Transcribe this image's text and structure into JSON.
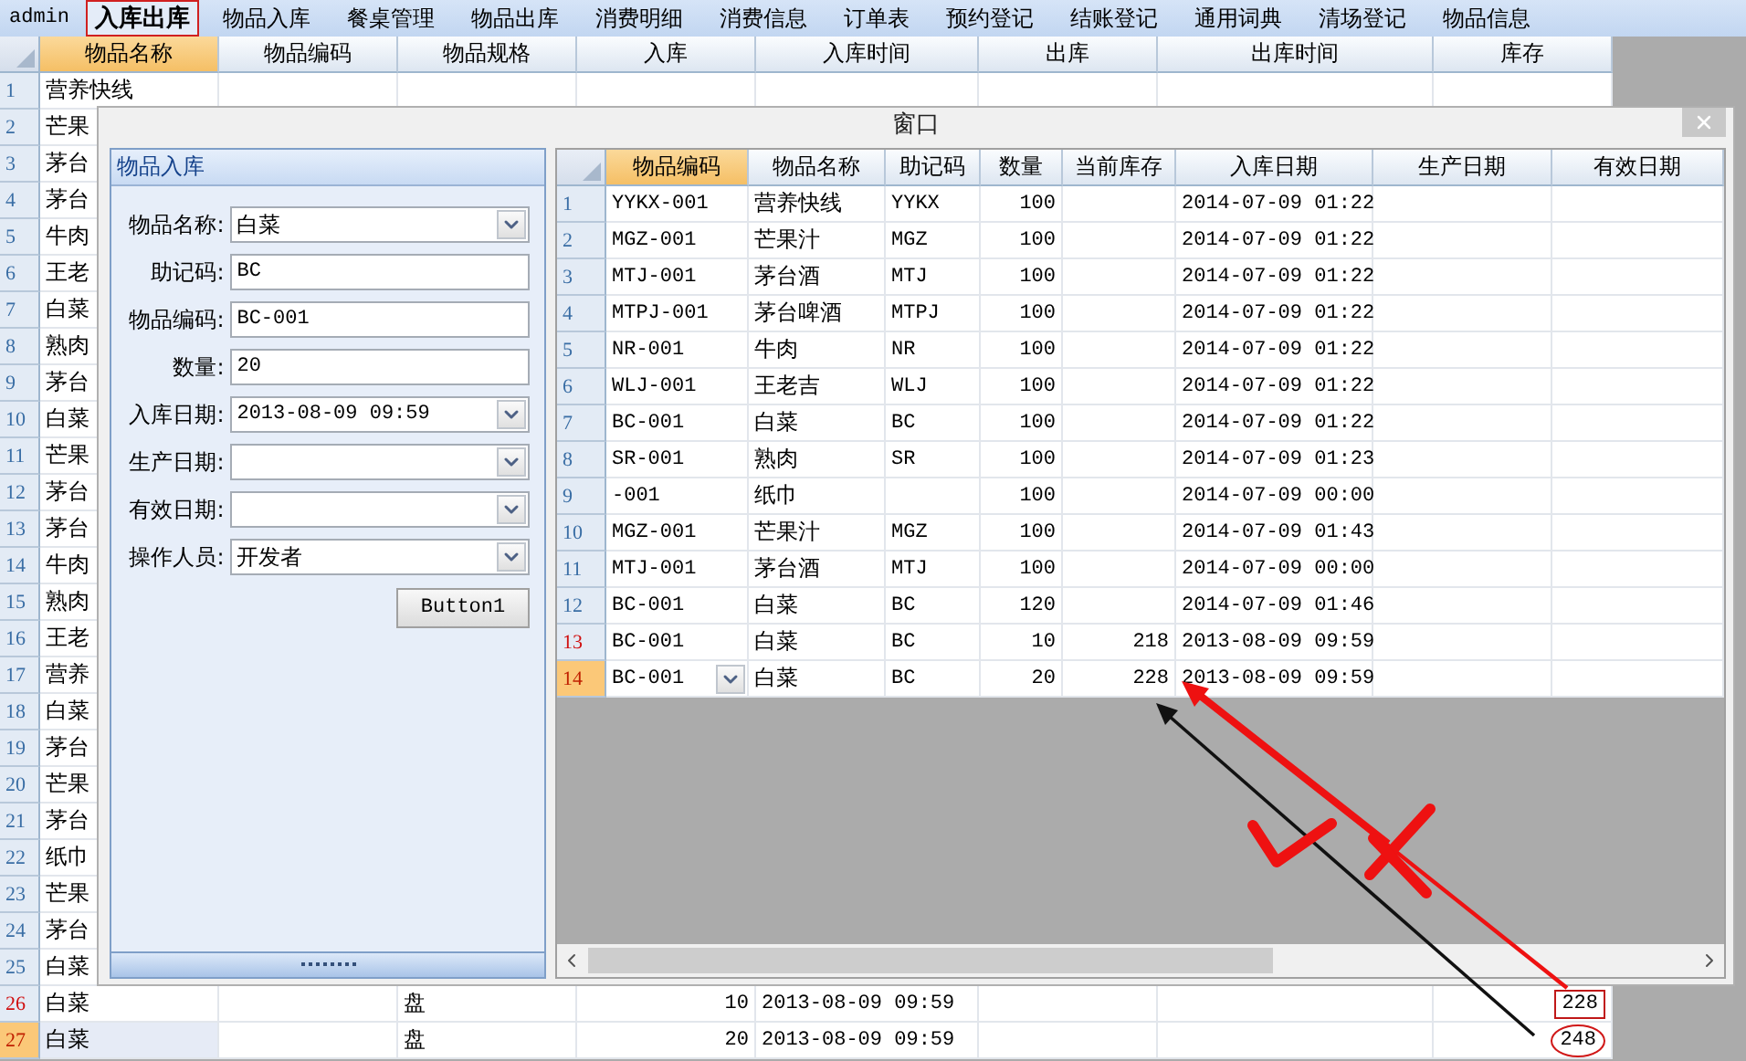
{
  "menu": {
    "user": "admin",
    "items": [
      {
        "label": "入库出库",
        "selected": true
      },
      {
        "label": "物品入库",
        "selected": false
      },
      {
        "label": "餐桌管理",
        "selected": false
      },
      {
        "label": "物品出库",
        "selected": false
      },
      {
        "label": "消费明细",
        "selected": false
      },
      {
        "label": "消费信息",
        "selected": false
      },
      {
        "label": "订单表",
        "selected": false
      },
      {
        "label": "预约登记",
        "selected": false
      },
      {
        "label": "结账登记",
        "selected": false
      },
      {
        "label": "通用词典",
        "selected": false
      },
      {
        "label": "清场登记",
        "selected": false
      },
      {
        "label": "物品信息",
        "selected": false
      }
    ]
  },
  "main_grid": {
    "columns": [
      {
        "label": "物品名称",
        "selected": true
      },
      {
        "label": "物品编码",
        "selected": false
      },
      {
        "label": "物品规格",
        "selected": false
      },
      {
        "label": "入库",
        "selected": false
      },
      {
        "label": "入库时间",
        "selected": false
      },
      {
        "label": "出库",
        "selected": false
      },
      {
        "label": "出库时间",
        "selected": false
      },
      {
        "label": "库存",
        "selected": false
      }
    ],
    "rows": [
      {
        "number": "1",
        "name": "营养快线",
        "selected": false,
        "modified": false
      },
      {
        "number": "2",
        "name": "芒果",
        "selected": false,
        "modified": false
      },
      {
        "number": "3",
        "name": "茅台",
        "selected": false,
        "modified": false
      },
      {
        "number": "4",
        "name": "茅台",
        "selected": false,
        "modified": false
      },
      {
        "number": "5",
        "name": "牛肉",
        "selected": false,
        "modified": false
      },
      {
        "number": "6",
        "name": "王老",
        "selected": false,
        "modified": false
      },
      {
        "number": "7",
        "name": "白菜",
        "selected": false,
        "modified": false
      },
      {
        "number": "8",
        "name": "熟肉",
        "selected": false,
        "modified": false
      },
      {
        "number": "9",
        "name": "茅台",
        "selected": false,
        "modified": false
      },
      {
        "number": "10",
        "name": "白菜",
        "selected": false,
        "modified": false
      },
      {
        "number": "11",
        "name": "芒果",
        "selected": false,
        "modified": false
      },
      {
        "number": "12",
        "name": "茅台",
        "selected": false,
        "modified": false
      },
      {
        "number": "13",
        "name": "茅台",
        "selected": false,
        "modified": false
      },
      {
        "number": "14",
        "name": "牛肉",
        "selected": false,
        "modified": false
      },
      {
        "number": "15",
        "name": "熟肉",
        "selected": false,
        "modified": false
      },
      {
        "number": "16",
        "name": "王老",
        "selected": false,
        "modified": false
      },
      {
        "number": "17",
        "name": "营养",
        "selected": false,
        "modified": false
      },
      {
        "number": "18",
        "name": "白菜",
        "selected": false,
        "modified": false
      },
      {
        "number": "19",
        "name": "茅台",
        "selected": false,
        "modified": false
      },
      {
        "number": "20",
        "name": "芒果",
        "selected": false,
        "modified": false
      },
      {
        "number": "21",
        "name": "茅台",
        "selected": false,
        "modified": false
      },
      {
        "number": "22",
        "name": "纸巾",
        "selected": false,
        "modified": false
      },
      {
        "number": "23",
        "name": "芒果",
        "selected": false,
        "modified": false
      },
      {
        "number": "24",
        "name": "茅台",
        "selected": false,
        "modified": false
      },
      {
        "number": "25",
        "name": "白菜",
        "selected": false,
        "modified": false
      },
      {
        "number": "26",
        "name": "白菜",
        "spec": "盘",
        "in": "10",
        "in_time": "2013-08-09 09:59",
        "stock": {
          "value": "228",
          "kind": "boxed"
        },
        "selected": false,
        "modified": true
      },
      {
        "number": "27",
        "name": "白菜",
        "spec": "盘",
        "in": "20",
        "in_time": "2013-08-09 09:59",
        "stock": {
          "value": "248",
          "kind": "circled"
        },
        "selected": true,
        "modified": false
      }
    ]
  },
  "dialog": {
    "title": "窗口",
    "form": {
      "title": "物品入库",
      "fields": [
        {
          "label": "物品名称:",
          "value": "白菜",
          "kind": "combo"
        },
        {
          "label": "助记码:",
          "value": "BC",
          "kind": "text"
        },
        {
          "label": "物品编码:",
          "value": "BC-001",
          "kind": "text"
        },
        {
          "label": "数量:",
          "value": "20",
          "kind": "text"
        },
        {
          "label": "入库日期:",
          "value": "2013-08-09 09:59",
          "kind": "combo"
        },
        {
          "label": "生产日期:",
          "kind": "combo"
        },
        {
          "label": "有效日期:",
          "kind": "combo"
        },
        {
          "label": "操作人员:",
          "value": "开发者",
          "kind": "combo"
        }
      ],
      "button": "Button1"
    },
    "grid": {
      "columns": [
        {
          "label": "物品编码",
          "selected": true
        },
        {
          "label": "物品名称",
          "selected": false
        },
        {
          "label": "助记码",
          "selected": false
        },
        {
          "label": "数量",
          "selected": false
        },
        {
          "label": "当前库存",
          "selected": false
        },
        {
          "label": "入库日期",
          "selected": false
        },
        {
          "label": "生产日期",
          "selected": false
        },
        {
          "label": "有效日期",
          "selected": false
        }
      ],
      "rows": [
        {
          "number": "1",
          "code": "YYKX-001",
          "name": "营养快线",
          "mnemonic": "YYKX",
          "quantity": "100",
          "in_date": "2014-07-09 01:22",
          "selected": false,
          "modified": false
        },
        {
          "number": "2",
          "code": "MGZ-001",
          "name": "芒果汁",
          "mnemonic": "MGZ",
          "quantity": "100",
          "in_date": "2014-07-09 01:22",
          "selected": false,
          "modified": false
        },
        {
          "number": "3",
          "code": "MTJ-001",
          "name": "茅台酒",
          "mnemonic": "MTJ",
          "quantity": "100",
          "in_date": "2014-07-09 01:22",
          "selected": false,
          "modified": false
        },
        {
          "number": "4",
          "code": "MTPJ-001",
          "name": "茅台啤酒",
          "mnemonic": "MTPJ",
          "quantity": "100",
          "in_date": "2014-07-09 01:22",
          "selected": false,
          "modified": false
        },
        {
          "number": "5",
          "code": "NR-001",
          "name": "牛肉",
          "mnemonic": "NR",
          "quantity": "100",
          "in_date": "2014-07-09 01:22",
          "selected": false,
          "modified": false
        },
        {
          "number": "6",
          "code": "WLJ-001",
          "name": "王老吉",
          "mnemonic": "WLJ",
          "quantity": "100",
          "in_date": "2014-07-09 01:22",
          "selected": false,
          "modified": false
        },
        {
          "number": "7",
          "code": "BC-001",
          "name": "白菜",
          "mnemonic": "BC",
          "quantity": "100",
          "in_date": "2014-07-09 01:22",
          "selected": false,
          "modified": false
        },
        {
          "number": "8",
          "code": "SR-001",
          "name": "熟肉",
          "mnemonic": "SR",
          "quantity": "100",
          "in_date": "2014-07-09 01:23",
          "selected": false,
          "modified": false
        },
        {
          "number": "9",
          "code": "-001",
          "name": "纸巾",
          "quantity": "100",
          "in_date": "2014-07-09 00:00",
          "selected": false,
          "modified": false
        },
        {
          "number": "10",
          "code": "MGZ-001",
          "name": "芒果汁",
          "mnemonic": "MGZ",
          "quantity": "100",
          "in_date": "2014-07-09 01:43",
          "selected": false,
          "modified": false
        },
        {
          "number": "11",
          "code": "MTJ-001",
          "name": "茅台酒",
          "mnemonic": "MTJ",
          "quantity": "100",
          "in_date": "2014-07-09 00:00",
          "selected": false,
          "modified": false
        },
        {
          "number": "12",
          "code": "BC-001",
          "name": "白菜",
          "mnemonic": "BC",
          "quantity": "120",
          "in_date": "2014-07-09 01:46",
          "selected": false,
          "modified": false
        },
        {
          "number": "13",
          "code": "BC-001",
          "name": "白菜",
          "mnemonic": "BC",
          "quantity": "10",
          "current_stock": "218",
          "in_date": "2013-08-09 09:59",
          "selected": false,
          "modified": true
        },
        {
          "number": "14",
          "code": "BC-001",
          "name": "白菜",
          "mnemonic": "BC",
          "quantity": "20",
          "current_stock": "228",
          "in_date": "2013-08-09 09:59",
          "selected": true,
          "modified": false
        }
      ]
    }
  }
}
